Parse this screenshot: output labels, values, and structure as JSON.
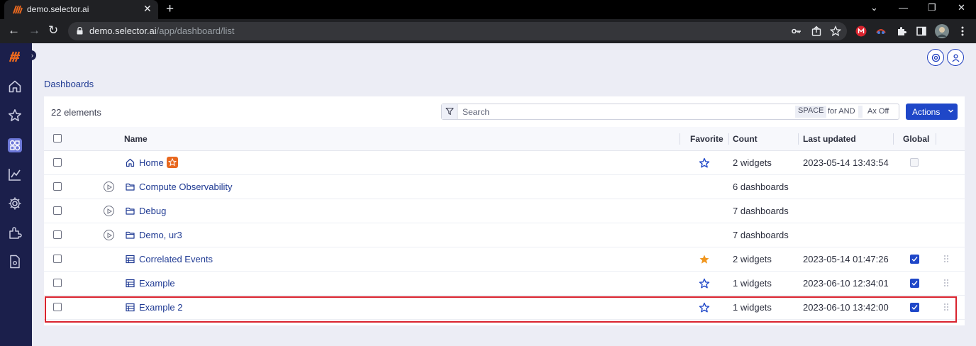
{
  "browser": {
    "tab_title": "demo.selector.ai",
    "tab_close": "✕",
    "new_tab": "+",
    "url_host": "demo.selector.ai",
    "url_path": "/app/dashboard/list",
    "window_controls": [
      "⌄",
      "—",
      "❐",
      "✕"
    ],
    "nav": {
      "back": "←",
      "forward": "→",
      "reload": "↻"
    }
  },
  "sidebar": {
    "items": [
      {
        "icon": "logo-icon"
      },
      {
        "icon": "home-icon"
      },
      {
        "icon": "star-icon"
      },
      {
        "icon": "dashboards-icon",
        "active": true
      },
      {
        "icon": "analytics-icon"
      },
      {
        "icon": "settings-icon"
      },
      {
        "icon": "integrations-icon"
      },
      {
        "icon": "docs-icon"
      }
    ],
    "expand": "›"
  },
  "breadcrumb": "Dashboards",
  "list": {
    "count_label": "22 elements",
    "search_placeholder": "Search",
    "kbd_space": "SPACE",
    "hint_for_and": "for AND",
    "ax_off": "Ax Off",
    "actions_label": "Actions"
  },
  "columns": {
    "name": "Name",
    "favorite": "Favorite",
    "count": "Count",
    "last_updated": "Last updated",
    "global": "Global"
  },
  "rows": [
    {
      "type": "home",
      "name": "Home",
      "favorite": false,
      "count": "2 widgets",
      "updated": "2023-05-14 13:43:54",
      "global": "disabled"
    },
    {
      "type": "folder",
      "name": "Compute Observability",
      "count": "6 dashboards"
    },
    {
      "type": "folder",
      "name": "Debug",
      "count": "7 dashboards"
    },
    {
      "type": "folder",
      "name": "Demo, ur3",
      "count": "7 dashboards"
    },
    {
      "type": "dashboard",
      "name": "Correlated Events",
      "favorite": true,
      "count": "2 widgets",
      "updated": "2023-05-14 01:47:26",
      "global": "checked"
    },
    {
      "type": "dashboard",
      "name": "Example",
      "favorite": false,
      "count": "1 widgets",
      "updated": "2023-06-10 12:34:01",
      "global": "checked"
    },
    {
      "type": "dashboard",
      "name": "Example 2",
      "favorite": false,
      "count": "1 widgets",
      "updated": "2023-06-10 13:42:00",
      "global": "checked",
      "highlighted": true
    }
  ],
  "colors": {
    "sidebar": "#1b1f4b",
    "accent": "#1f47c8",
    "link": "#1f3a93",
    "star_filled": "#f0961e",
    "highlight": "#d9232e"
  }
}
